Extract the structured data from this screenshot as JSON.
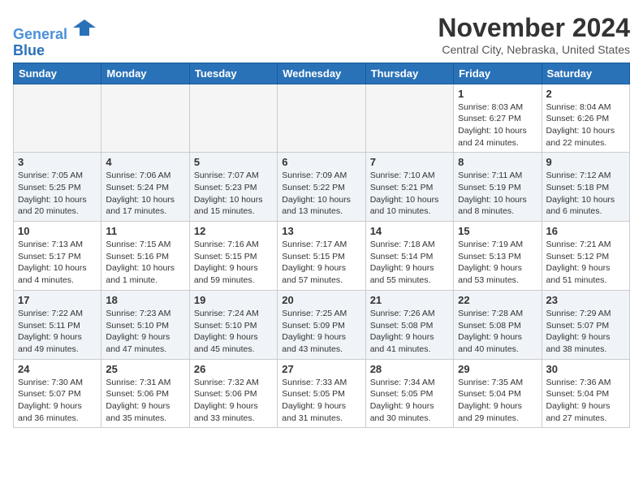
{
  "header": {
    "logo_line1": "General",
    "logo_line2": "Blue",
    "month_title": "November 2024",
    "location": "Central City, Nebraska, United States"
  },
  "weekdays": [
    "Sunday",
    "Monday",
    "Tuesday",
    "Wednesday",
    "Thursday",
    "Friday",
    "Saturday"
  ],
  "weeks": [
    [
      {
        "day": "",
        "empty": true
      },
      {
        "day": "",
        "empty": true
      },
      {
        "day": "",
        "empty": true
      },
      {
        "day": "",
        "empty": true
      },
      {
        "day": "",
        "empty": true
      },
      {
        "day": "1",
        "sunrise": "Sunrise: 8:03 AM",
        "sunset": "Sunset: 6:27 PM",
        "daylight": "Daylight: 10 hours and 24 minutes."
      },
      {
        "day": "2",
        "sunrise": "Sunrise: 8:04 AM",
        "sunset": "Sunset: 6:26 PM",
        "daylight": "Daylight: 10 hours and 22 minutes."
      }
    ],
    [
      {
        "day": "3",
        "sunrise": "Sunrise: 7:05 AM",
        "sunset": "Sunset: 5:25 PM",
        "daylight": "Daylight: 10 hours and 20 minutes."
      },
      {
        "day": "4",
        "sunrise": "Sunrise: 7:06 AM",
        "sunset": "Sunset: 5:24 PM",
        "daylight": "Daylight: 10 hours and 17 minutes."
      },
      {
        "day": "5",
        "sunrise": "Sunrise: 7:07 AM",
        "sunset": "Sunset: 5:23 PM",
        "daylight": "Daylight: 10 hours and 15 minutes."
      },
      {
        "day": "6",
        "sunrise": "Sunrise: 7:09 AM",
        "sunset": "Sunset: 5:22 PM",
        "daylight": "Daylight: 10 hours and 13 minutes."
      },
      {
        "day": "7",
        "sunrise": "Sunrise: 7:10 AM",
        "sunset": "Sunset: 5:21 PM",
        "daylight": "Daylight: 10 hours and 10 minutes."
      },
      {
        "day": "8",
        "sunrise": "Sunrise: 7:11 AM",
        "sunset": "Sunset: 5:19 PM",
        "daylight": "Daylight: 10 hours and 8 minutes."
      },
      {
        "day": "9",
        "sunrise": "Sunrise: 7:12 AM",
        "sunset": "Sunset: 5:18 PM",
        "daylight": "Daylight: 10 hours and 6 minutes."
      }
    ],
    [
      {
        "day": "10",
        "sunrise": "Sunrise: 7:13 AM",
        "sunset": "Sunset: 5:17 PM",
        "daylight": "Daylight: 10 hours and 4 minutes."
      },
      {
        "day": "11",
        "sunrise": "Sunrise: 7:15 AM",
        "sunset": "Sunset: 5:16 PM",
        "daylight": "Daylight: 10 hours and 1 minute."
      },
      {
        "day": "12",
        "sunrise": "Sunrise: 7:16 AM",
        "sunset": "Sunset: 5:15 PM",
        "daylight": "Daylight: 9 hours and 59 minutes."
      },
      {
        "day": "13",
        "sunrise": "Sunrise: 7:17 AM",
        "sunset": "Sunset: 5:15 PM",
        "daylight": "Daylight: 9 hours and 57 minutes."
      },
      {
        "day": "14",
        "sunrise": "Sunrise: 7:18 AM",
        "sunset": "Sunset: 5:14 PM",
        "daylight": "Daylight: 9 hours and 55 minutes."
      },
      {
        "day": "15",
        "sunrise": "Sunrise: 7:19 AM",
        "sunset": "Sunset: 5:13 PM",
        "daylight": "Daylight: 9 hours and 53 minutes."
      },
      {
        "day": "16",
        "sunrise": "Sunrise: 7:21 AM",
        "sunset": "Sunset: 5:12 PM",
        "daylight": "Daylight: 9 hours and 51 minutes."
      }
    ],
    [
      {
        "day": "17",
        "sunrise": "Sunrise: 7:22 AM",
        "sunset": "Sunset: 5:11 PM",
        "daylight": "Daylight: 9 hours and 49 minutes."
      },
      {
        "day": "18",
        "sunrise": "Sunrise: 7:23 AM",
        "sunset": "Sunset: 5:10 PM",
        "daylight": "Daylight: 9 hours and 47 minutes."
      },
      {
        "day": "19",
        "sunrise": "Sunrise: 7:24 AM",
        "sunset": "Sunset: 5:10 PM",
        "daylight": "Daylight: 9 hours and 45 minutes."
      },
      {
        "day": "20",
        "sunrise": "Sunrise: 7:25 AM",
        "sunset": "Sunset: 5:09 PM",
        "daylight": "Daylight: 9 hours and 43 minutes."
      },
      {
        "day": "21",
        "sunrise": "Sunrise: 7:26 AM",
        "sunset": "Sunset: 5:08 PM",
        "daylight": "Daylight: 9 hours and 41 minutes."
      },
      {
        "day": "22",
        "sunrise": "Sunrise: 7:28 AM",
        "sunset": "Sunset: 5:08 PM",
        "daylight": "Daylight: 9 hours and 40 minutes."
      },
      {
        "day": "23",
        "sunrise": "Sunrise: 7:29 AM",
        "sunset": "Sunset: 5:07 PM",
        "daylight": "Daylight: 9 hours and 38 minutes."
      }
    ],
    [
      {
        "day": "24",
        "sunrise": "Sunrise: 7:30 AM",
        "sunset": "Sunset: 5:07 PM",
        "daylight": "Daylight: 9 hours and 36 minutes."
      },
      {
        "day": "25",
        "sunrise": "Sunrise: 7:31 AM",
        "sunset": "Sunset: 5:06 PM",
        "daylight": "Daylight: 9 hours and 35 minutes."
      },
      {
        "day": "26",
        "sunrise": "Sunrise: 7:32 AM",
        "sunset": "Sunset: 5:06 PM",
        "daylight": "Daylight: 9 hours and 33 minutes."
      },
      {
        "day": "27",
        "sunrise": "Sunrise: 7:33 AM",
        "sunset": "Sunset: 5:05 PM",
        "daylight": "Daylight: 9 hours and 31 minutes."
      },
      {
        "day": "28",
        "sunrise": "Sunrise: 7:34 AM",
        "sunset": "Sunset: 5:05 PM",
        "daylight": "Daylight: 9 hours and 30 minutes."
      },
      {
        "day": "29",
        "sunrise": "Sunrise: 7:35 AM",
        "sunset": "Sunset: 5:04 PM",
        "daylight": "Daylight: 9 hours and 29 minutes."
      },
      {
        "day": "30",
        "sunrise": "Sunrise: 7:36 AM",
        "sunset": "Sunset: 5:04 PM",
        "daylight": "Daylight: 9 hours and 27 minutes."
      }
    ]
  ]
}
